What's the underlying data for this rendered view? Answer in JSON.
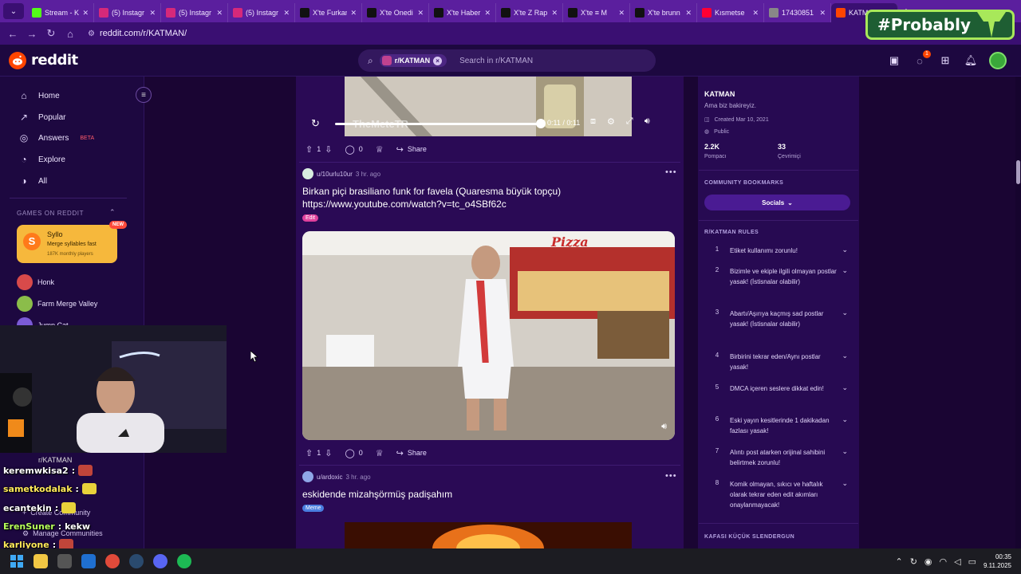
{
  "browser": {
    "tabs": [
      {
        "label": "Stream - K",
        "color": "#53fc18"
      },
      {
        "label": "(5) Instagr",
        "color": "#d6297a"
      },
      {
        "label": "(5) Instagr",
        "color": "#d6297a"
      },
      {
        "label": "(5) Instagr",
        "color": "#d6297a"
      },
      {
        "label": "X'te Furkan",
        "color": "#111111"
      },
      {
        "label": "X'te Onedi",
        "color": "#111111"
      },
      {
        "label": "X'te Haber",
        "color": "#111111"
      },
      {
        "label": "X'te Z Rap",
        "color": "#111111"
      },
      {
        "label": "X'te ≡ M",
        "color": "#111111"
      },
      {
        "label": "X'te brunn",
        "color": "#111111"
      },
      {
        "label": "Kısmetse",
        "color": "#ff0033"
      },
      {
        "label": "17430851",
        "color": "#888888"
      },
      {
        "label": "KATM",
        "color": "#ff4500",
        "active": true
      }
    ],
    "url": "reddit.com/r/KATMAN/"
  },
  "overlay": {
    "text": "#Probably"
  },
  "header": {
    "logo_text": "reddit",
    "search_chip": "r/KATMAN",
    "search_placeholder": "Search in r/KATMAN",
    "notif_badge": "1"
  },
  "left_sidebar": {
    "nav": [
      {
        "label": "Home",
        "icon": "⌂"
      },
      {
        "label": "Popular",
        "icon": "↗"
      },
      {
        "label": "Answers",
        "icon": "◎",
        "badge": "BETA"
      },
      {
        "label": "Explore",
        "icon": "◔"
      },
      {
        "label": "All",
        "icon": "◑"
      }
    ],
    "games_title": "GAMES ON REDDIT",
    "featured_game": {
      "name": "Syllo",
      "desc": "Merge syllables fast",
      "players": "187K monthly players",
      "badge": "NEW"
    },
    "games": [
      {
        "name": "Honk",
        "color": "#d84a4a"
      },
      {
        "name": "Farm Merge Valley",
        "color": "#8bbd4a"
      },
      {
        "name": "Jump Cat",
        "color": "#7b5bd6"
      }
    ],
    "community": "r/KATMAN",
    "create_community": "Create Community",
    "manage_communities": "Manage Communities"
  },
  "chat": [
    {
      "user": "keremwkisa2",
      "color": "#ffffff"
    },
    {
      "user": "sametkodalak",
      "color": "#ffe95a"
    },
    {
      "user": "ecantekin",
      "color": "#ffffff"
    },
    {
      "user": "ErenSuner",
      "color": "#b6ff5a",
      "msg": "kekw"
    },
    {
      "user": "karliyone",
      "color": "#ffe95a"
    }
  ],
  "video": {
    "watermark": "TheMeteTR",
    "time": "0:11 / 0:11"
  },
  "posts": [
    {
      "up": "1",
      "comments": "0",
      "share": "Share"
    },
    {
      "author": "u/10urlu10ur",
      "age": "3 hr. ago",
      "title": "Birkan piçi brasiliano funk for favela (Quaresma büyük topçu)",
      "link": "https://www.youtube.com/watch?v=tc_o4SBf62c",
      "flair": "Edit",
      "image_sign": "Pizza",
      "up": "1",
      "comments": "0",
      "share": "Share"
    },
    {
      "author": "u/ardoxic",
      "age": "3 hr. ago",
      "title": "eskidende mizahşörmüş padişahım",
      "flair": "Meme"
    }
  ],
  "right_sidebar": {
    "name": "KATMAN",
    "tagline": "Ama biz bakireyiz.",
    "created": "Created Mar 10, 2021",
    "visibility": "Public",
    "stats": [
      {
        "value": "2.2K",
        "label": "Pompacı"
      },
      {
        "value": "33",
        "label": "Çevrimiçi"
      }
    ],
    "bookmarks_title": "COMMUNITY BOOKMARKS",
    "bookmark_button": "Socials",
    "rules_title": "R/KATMAN RULES",
    "rules": [
      {
        "n": "1",
        "text": "Etiket kullanımı zorunlu!"
      },
      {
        "n": "2",
        "text": "Bizimle ve ekiple ilgili olmayan postlar yasak! (İstisnalar olabilir)"
      },
      {
        "n": "3",
        "text": "Abartı/Aşırıya kaçmış sad postlar yasak! (İstisnalar olabilir)"
      },
      {
        "n": "4",
        "text": "Birbirini tekrar eden/Aynı postlar yasak!"
      },
      {
        "n": "5",
        "text": "DMCA içeren seslere dikkat edin!"
      },
      {
        "n": "6",
        "text": "Eski yayın kesitlerinde 1 dakikadan fazlası yasak!"
      },
      {
        "n": "7",
        "text": "Alıntı post atarken orijinal sahibini belirtmek zorunlu!"
      },
      {
        "n": "8",
        "text": "Komik olmayan, sıkıcı ve haftalık olarak tekrar eden edit akımları onaylanmayacak!"
      }
    ],
    "next_section": "KAFASI KÜÇÜK SLENDERGUN"
  },
  "taskbar": {
    "time": "00:35",
    "date": "9.11.2025"
  }
}
